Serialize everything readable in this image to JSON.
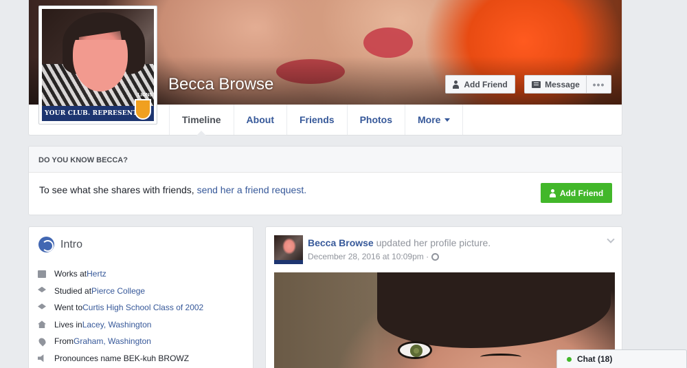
{
  "profile": {
    "name": "Becca Browse",
    "club_banner": "YOUR CLUB. REPRESENT.",
    "club_badge_text": "LIONS"
  },
  "cover_actions": {
    "add_friend": "Add Friend",
    "message": "Message",
    "more": "•••"
  },
  "nav": {
    "tabs": [
      {
        "label": "Timeline",
        "active": true
      },
      {
        "label": "About"
      },
      {
        "label": "Friends"
      },
      {
        "label": "Photos"
      },
      {
        "label": "More"
      }
    ]
  },
  "know": {
    "header": "DO YOU KNOW BECCA?",
    "text": "To see what she shares with friends,",
    "link": "send her a friend request.",
    "button": "Add Friend"
  },
  "intro": {
    "title": "Intro",
    "items": [
      {
        "icon": "briefcase-icon",
        "prefix": "Works at ",
        "link": "Hertz"
      },
      {
        "icon": "graduation-cap-icon",
        "prefix": "Studied at ",
        "link": "Pierce College"
      },
      {
        "icon": "graduation-cap-icon",
        "prefix": "Went to ",
        "link": "Curtis High School Class of 2002"
      },
      {
        "icon": "home-icon",
        "prefix": "Lives in ",
        "link": "Lacey, Washington"
      },
      {
        "icon": "location-pin-icon",
        "prefix": "From ",
        "link": "Graham, Washington"
      },
      {
        "icon": "speaker-icon",
        "prefix": "Pronounces name BEK-kuh BROWZ",
        "link": ""
      }
    ]
  },
  "post": {
    "author": "Becca Browse",
    "action": " updated her profile picture.",
    "date": "December 28, 2016 at 10:09pm ·"
  },
  "chat": {
    "label": "Chat (18)"
  },
  "colors": {
    "link_blue": "#365899",
    "green_button": "#42b72a",
    "page_bg": "#e9ebee"
  }
}
